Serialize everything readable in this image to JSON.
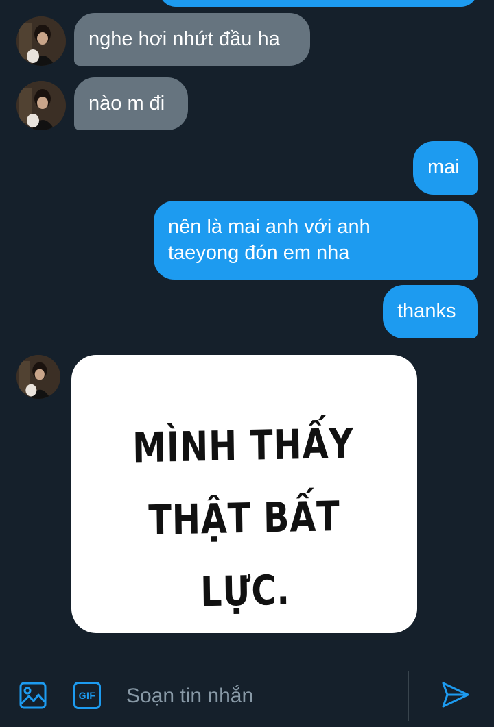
{
  "colors": {
    "background": "#15202b",
    "incoming_bubble": "#66747f",
    "outgoing_bubble": "#1d9bf0",
    "accent": "#1d9bf0",
    "placeholder": "#8899a6",
    "divider": "#38444d"
  },
  "messages": [
    {
      "direction": "incoming",
      "text": "nghe hơi nhứt đầu ha"
    },
    {
      "direction": "incoming",
      "text": "nào m đi"
    },
    {
      "direction": "outgoing",
      "text": "mai"
    },
    {
      "direction": "outgoing",
      "text": "nên là mai anh với anh\ntaeyong đón em nha"
    },
    {
      "direction": "outgoing",
      "text": "thanks"
    },
    {
      "direction": "incoming",
      "type": "sticker",
      "text": "MÌNH THẤY\nTHẬT BẤT LỰC."
    }
  ],
  "composer": {
    "placeholder": "Soạn tin nhắn",
    "image_icon": "image-icon",
    "gif_label": "GIF",
    "send_icon": "send-icon"
  }
}
